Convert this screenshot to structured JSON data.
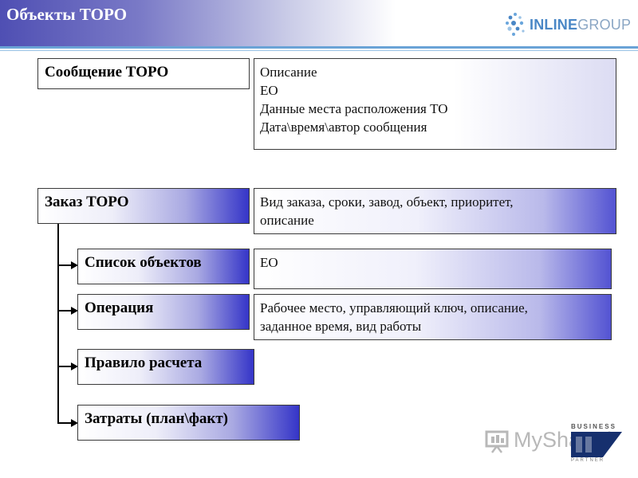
{
  "header": {
    "title": "Объекты ТОРО",
    "brand_primary": "INLINE",
    "brand_secondary": "GROUP"
  },
  "objects": [
    {
      "label": "Сообщение ТОРО",
      "description": [
        "Описание",
        "ЕО",
        "Данные места расположения ТО",
        "Дата\\время\\автор сообщения"
      ]
    },
    {
      "label": "Заказ ТОРО",
      "description": [
        "Вид заказа, сроки, завод, объект, приоритет,",
        "описание"
      ]
    },
    {
      "label": "Список объектов",
      "description": [
        "ЕО"
      ]
    },
    {
      "label": "Операция",
      "description": [
        "Рабочее место, управляющий ключ, описание,",
        "заданное время, вид работы"
      ]
    },
    {
      "label": "Правило расчета"
    },
    {
      "label": "Затраты (план\\факт)"
    }
  ],
  "watermark": {
    "text": "MyShared",
    "badge_top": "BUSINESS",
    "badge_bottom": "PARTNER"
  },
  "colors": {
    "accent": "#3535c8",
    "header": "#4f4fb3",
    "brand": "#4a87c6"
  }
}
